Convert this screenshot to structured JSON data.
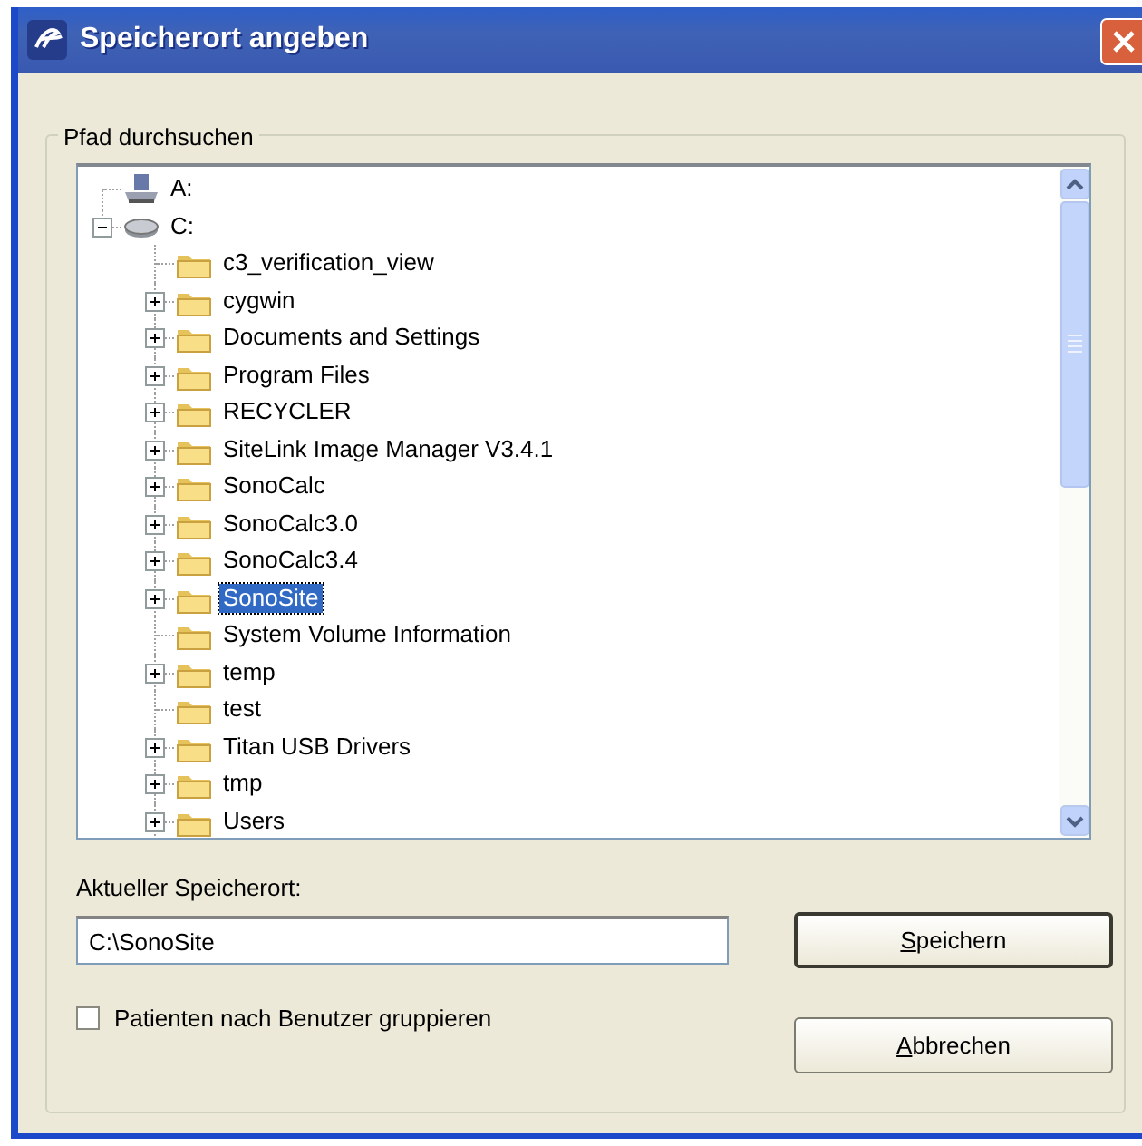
{
  "window": {
    "title": "Speicherort angeben"
  },
  "browse_group": {
    "legend": "Pfad durchsuchen"
  },
  "tree": [
    {
      "label": "A:",
      "kind": "floppy",
      "expandable": false,
      "selected": false
    },
    {
      "label": "C:",
      "kind": "disk",
      "expandable": true,
      "expanded": true,
      "selected": false,
      "children": [
        {
          "label": "c3_verification_view",
          "kind": "folder",
          "expandable": false,
          "selected": false
        },
        {
          "label": "cygwin",
          "kind": "folder",
          "expandable": true,
          "expanded": false,
          "selected": false
        },
        {
          "label": "Documents and Settings",
          "kind": "folder",
          "expandable": true,
          "expanded": false,
          "selected": false
        },
        {
          "label": "Program Files",
          "kind": "folder",
          "expandable": true,
          "expanded": false,
          "selected": false
        },
        {
          "label": "RECYCLER",
          "kind": "folder",
          "expandable": true,
          "expanded": false,
          "selected": false
        },
        {
          "label": "SiteLink Image Manager V3.4.1",
          "kind": "folder",
          "expandable": true,
          "expanded": false,
          "selected": false
        },
        {
          "label": "SonoCalc",
          "kind": "folder",
          "expandable": true,
          "expanded": false,
          "selected": false
        },
        {
          "label": "SonoCalc3.0",
          "kind": "folder",
          "expandable": true,
          "expanded": false,
          "selected": false
        },
        {
          "label": "SonoCalc3.4",
          "kind": "folder",
          "expandable": true,
          "expanded": false,
          "selected": false
        },
        {
          "label": "SonoSite",
          "kind": "folder",
          "expandable": true,
          "expanded": false,
          "selected": true
        },
        {
          "label": "System Volume Information",
          "kind": "folder",
          "expandable": false,
          "selected": false
        },
        {
          "label": "temp",
          "kind": "folder",
          "expandable": true,
          "expanded": false,
          "selected": false
        },
        {
          "label": "test",
          "kind": "folder",
          "expandable": false,
          "selected": false
        },
        {
          "label": "Titan USB Drivers",
          "kind": "folder",
          "expandable": true,
          "expanded": false,
          "selected": false
        },
        {
          "label": "tmp",
          "kind": "folder",
          "expandable": true,
          "expanded": false,
          "selected": false
        },
        {
          "label": "Users",
          "kind": "folder",
          "expandable": true,
          "expanded": false,
          "selected": false
        }
      ]
    }
  ],
  "location": {
    "label": "Aktueller Speicherort:",
    "value": "C:\\SonoSite"
  },
  "group_option": {
    "label": "Patienten nach Benutzer gruppieren",
    "checked": false
  },
  "buttons": [
    {
      "label": "Speichern",
      "default": true,
      "mnemonic_first": true
    },
    {
      "label": "Abbrechen",
      "default": false,
      "mnemonic_first": true
    }
  ]
}
